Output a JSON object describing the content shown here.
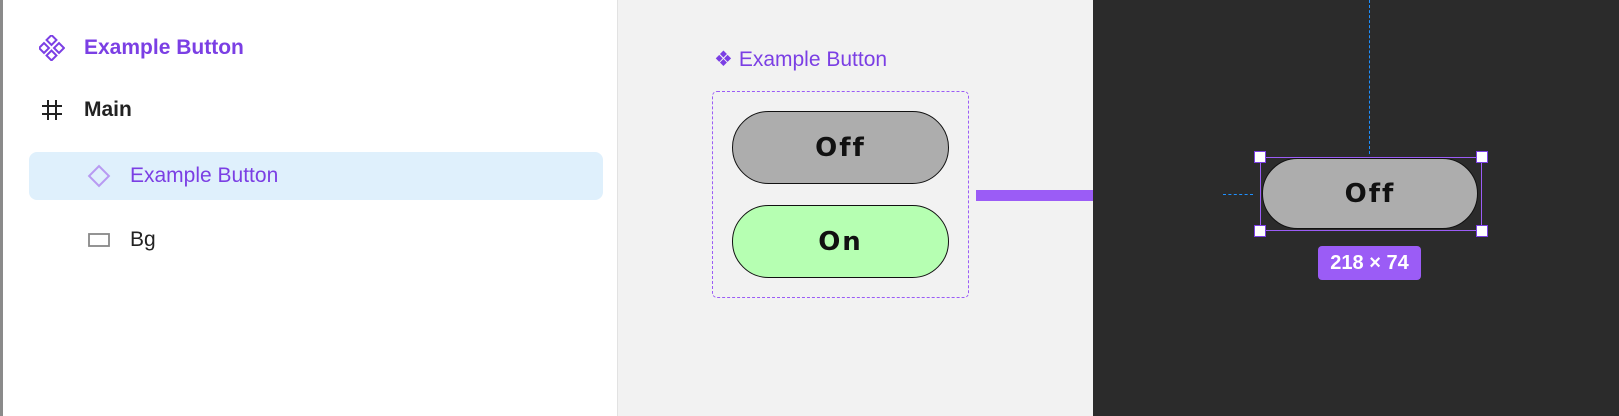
{
  "layers_panel": {
    "items": [
      {
        "label": "Example Button",
        "icon": "component-set-icon"
      },
      {
        "label": "Main",
        "icon": "frame-icon"
      },
      {
        "label": "Example Button",
        "icon": "component-variant-icon",
        "selected": true
      },
      {
        "label": "Bg",
        "icon": "rectangle-icon"
      }
    ]
  },
  "component_set": {
    "title_glyph": "❖",
    "title": "Example Button",
    "variants": [
      {
        "label": "Off",
        "fill": "#adadad"
      },
      {
        "label": "On",
        "fill": "#b6ffb2"
      }
    ]
  },
  "instance": {
    "label": "Off",
    "fill": "#adadad",
    "size_badge": "218 × 74"
  },
  "colors": {
    "accent": "#9b5cf6",
    "accent_text": "#7b3fe4",
    "selection_bg": "#dff0fc",
    "guide": "#1e90ff",
    "dark_canvas": "#2b2b2b"
  }
}
